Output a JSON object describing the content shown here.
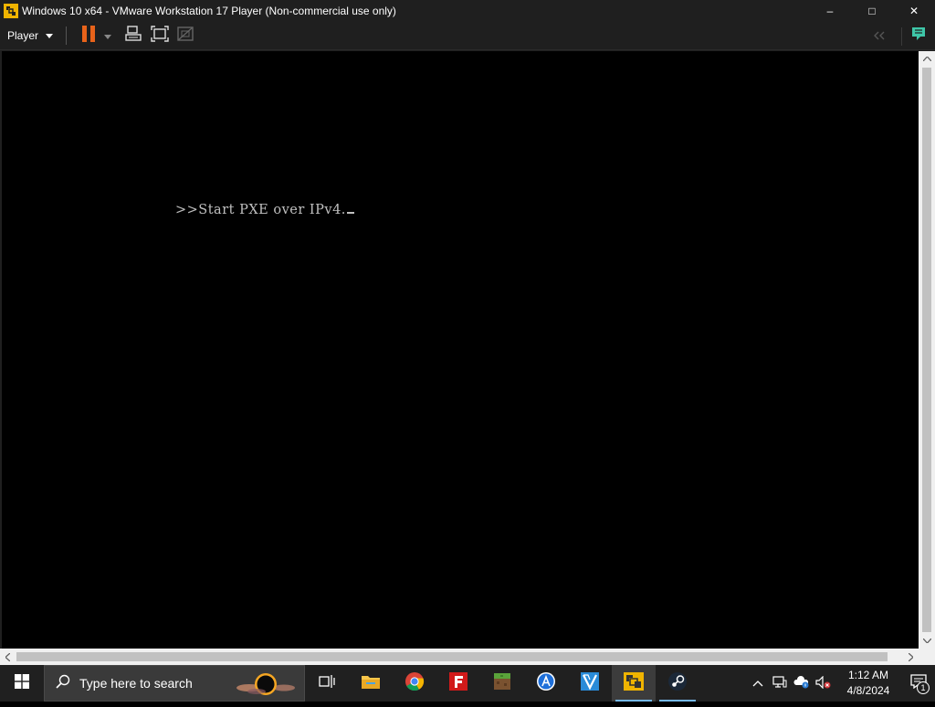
{
  "window": {
    "title": "Windows 10 x64 - VMware Workstation 17 Player (Non-commercial use only)",
    "controls": {
      "minimize_glyph": "–",
      "maximize_glyph": "□",
      "close_glyph": "✕"
    }
  },
  "toolbar": {
    "player_label": "Player",
    "buttons": [
      "pause-icon",
      "send-ctrl-alt-del-icon",
      "fullscreen-icon",
      "unity-icon"
    ],
    "right_buttons": [
      "collapse-toolbar-icon",
      "message-log-icon"
    ]
  },
  "console": {
    "line": ">>Start PXE over IPv4."
  },
  "taskbar": {
    "search_placeholder": "Type here to search",
    "apps": [
      "task-view-icon",
      "file-explorer-icon",
      "chrome-icon",
      "f-app-icon",
      "minecraft-icon",
      "app-store-icon",
      "vs-app-icon",
      "vmware-icon",
      "steam-icon"
    ],
    "clock_time": "1:12 AM",
    "clock_date": "4/8/2024",
    "notification_count": "1"
  },
  "colors": {
    "titlebar_bg": "#1f1f1f",
    "console_text": "#c0c0c0",
    "pause_orange": "#e8631a",
    "taskbar_bg": "#202020",
    "accent_green": "#3ec6a8"
  }
}
